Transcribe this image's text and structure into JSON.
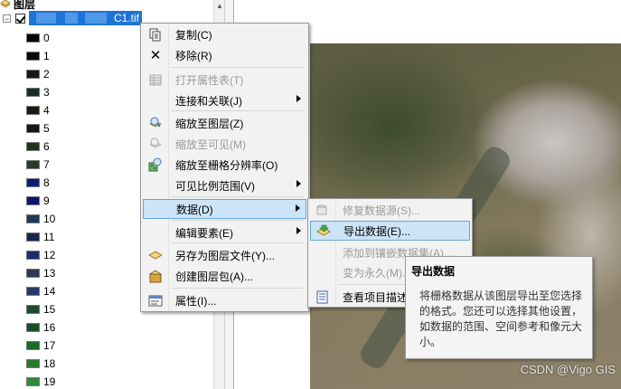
{
  "toc": {
    "header": "图层",
    "layer_name": "C1.tif",
    "classes": [
      {
        "label": "0",
        "color": "#000000"
      },
      {
        "label": "1",
        "color": "#070707"
      },
      {
        "label": "2",
        "color": "#121a12"
      },
      {
        "label": "3",
        "color": "#183024"
      },
      {
        "label": "4",
        "color": "#1a1a14"
      },
      {
        "label": "5",
        "color": "#14161c"
      },
      {
        "label": "6",
        "color": "#24321c"
      },
      {
        "label": "7",
        "color": "#2a3a2a"
      },
      {
        "label": "8",
        "color": "#0e1a7a"
      },
      {
        "label": "9",
        "color": "#0c1670"
      },
      {
        "label": "10",
        "color": "#1e3a5a"
      },
      {
        "label": "11",
        "color": "#16264e"
      },
      {
        "label": "12",
        "color": "#1e2a70"
      },
      {
        "label": "13",
        "color": "#2e3850"
      },
      {
        "label": "14",
        "color": "#263a6a"
      },
      {
        "label": "15",
        "color": "#1e4a2e"
      },
      {
        "label": "16",
        "color": "#1a4e2a"
      },
      {
        "label": "17",
        "color": "#1a6a2a"
      },
      {
        "label": "18",
        "color": "#2a7a2e"
      },
      {
        "label": "19",
        "color": "#2e8a36"
      }
    ]
  },
  "context_menu": {
    "items": [
      {
        "label": "复制(C)",
        "icon": "copy-icon",
        "disabled": false
      },
      {
        "label": "移除(R)",
        "icon": "remove-icon",
        "disabled": false
      },
      {
        "label": "打开属性表(T)",
        "icon": "table-icon",
        "disabled": true
      },
      {
        "label": "连接和关联(J)",
        "icon": "",
        "disabled": false,
        "submenu": true
      },
      {
        "label": "缩放至图层(Z)",
        "icon": "zoom-layer-icon",
        "disabled": false
      },
      {
        "label": "缩放至可见(M)",
        "icon": "zoom-visible-icon",
        "disabled": true
      },
      {
        "label": "缩放至栅格分辨率(O)",
        "icon": "zoom-raster-icon",
        "disabled": false
      },
      {
        "label": "可见比例范围(V)",
        "icon": "",
        "disabled": false,
        "submenu": true
      },
      {
        "label": "数据(D)",
        "icon": "",
        "disabled": false,
        "submenu": true,
        "highlighted": true
      },
      {
        "label": "编辑要素(E)",
        "icon": "",
        "disabled": false,
        "submenu": true
      },
      {
        "label": "另存为图层文件(Y)...",
        "icon": "layer-file-icon",
        "disabled": false
      },
      {
        "label": "创建图层包(A)...",
        "icon": "layer-package-icon",
        "disabled": false
      },
      {
        "label": "属性(I)...",
        "icon": "properties-icon",
        "disabled": false
      }
    ]
  },
  "data_submenu": {
    "items": [
      {
        "label": "修复数据源(S)...",
        "icon": "repair-source-icon",
        "disabled": true
      },
      {
        "label": "导出数据(E)...",
        "icon": "export-data-icon",
        "disabled": false,
        "highlighted": true
      },
      {
        "label": "添加到镶嵌数据集(A)...",
        "icon": "",
        "disabled": true
      },
      {
        "label": "变为永久(M)...",
        "icon": "",
        "disabled": true
      },
      {
        "label": "查看项目描述",
        "icon": "item-description-icon",
        "disabled": false
      }
    ]
  },
  "tooltip": {
    "title": "导出数据",
    "body": "将栅格数据从该图层导出至您选择的格式。您还可以选择其他设置，如数据的范围、空间参考和像元大小。"
  },
  "watermark": "CSDN @Vigo GIS"
}
